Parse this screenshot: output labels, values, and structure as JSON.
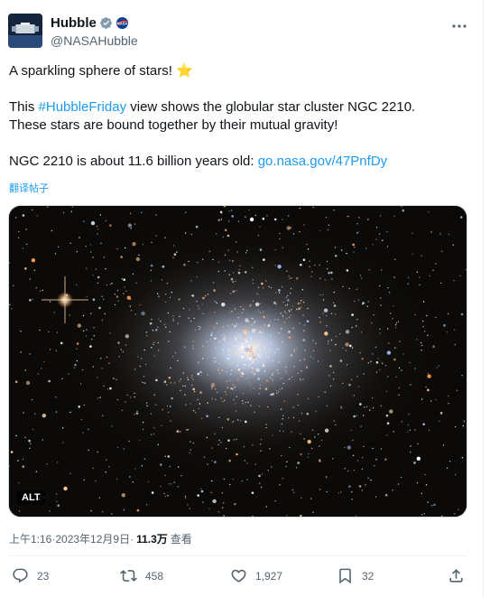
{
  "author": {
    "display_name": "Hubble",
    "handle": "@NASAHubble",
    "verified_badge": "verified-badge-icon",
    "affiliate_badge": "nasa-affiliate-icon"
  },
  "tweet": {
    "line1": "A sparkling sphere of stars! ",
    "emoji": "⭐",
    "line2_pre": "This ",
    "hashtag": "#HubbleFriday",
    "line2_post": " view shows the globular star cluster NGC 2210.",
    "line3": "These stars are bound together by their mutual gravity!",
    "line4_pre": "NGC 2210 is about 11.6 billion years old: ",
    "link": "go.nasa.gov/47PnfDy",
    "translate": "翻译帖子"
  },
  "media": {
    "alt_label": "ALT"
  },
  "meta": {
    "time": "上午1:16",
    "sep1": " · ",
    "date": "2023年12月9日",
    "sep2": " · ",
    "views": "11.3万",
    "views_label": "查看"
  },
  "actions": {
    "replies": "23",
    "reposts": "458",
    "likes": "1,927",
    "bookmarks": "32"
  },
  "colors": {
    "accent": "#1d9bf0",
    "muted": "#536471",
    "text": "#0f1419"
  }
}
